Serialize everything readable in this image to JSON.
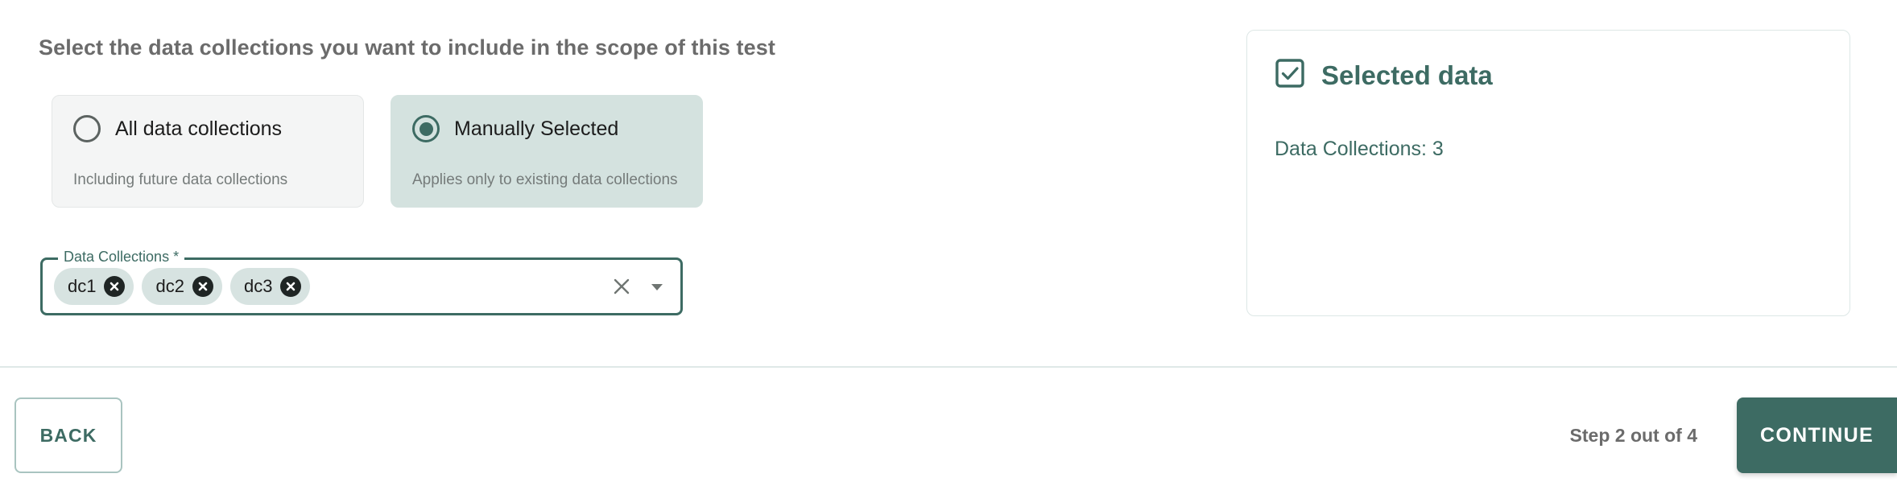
{
  "heading": "Select the data collections you want to include in the scope of this test",
  "scope_options": [
    {
      "id": "all-data-collections",
      "title": "All data collections",
      "subtitle": "Including future data collections",
      "selected": false
    },
    {
      "id": "manually-selected",
      "title": "Manually Selected",
      "subtitle": "Applies only to existing data collections",
      "selected": true
    }
  ],
  "select_field": {
    "label": "Data Collections *",
    "chips": [
      {
        "label": "dc1",
        "remove_icon": "circle-x-icon"
      },
      {
        "label": "dc2",
        "remove_icon": "circle-x-icon"
      },
      {
        "label": "dc3",
        "remove_icon": "circle-x-icon"
      }
    ],
    "clear_icon": "close-x-icon",
    "dropdown_icon": "chevron-down-icon"
  },
  "summary": {
    "icon": "checkbox-checked-icon",
    "title": "Selected data",
    "detail": "Data Collections: 3"
  },
  "footer": {
    "back_label": "BACK",
    "step_text": "Step 2 out of 4",
    "continue_label": "CONTINUE"
  },
  "colors": {
    "accent": "#3d6b63",
    "selected_card_bg": "#d4e2df",
    "unselected_card_bg": "#f4f5f5",
    "chip_bg": "#d7e3e1",
    "heading_text": "#6b6b6b",
    "divider": "#dfe8e7"
  }
}
